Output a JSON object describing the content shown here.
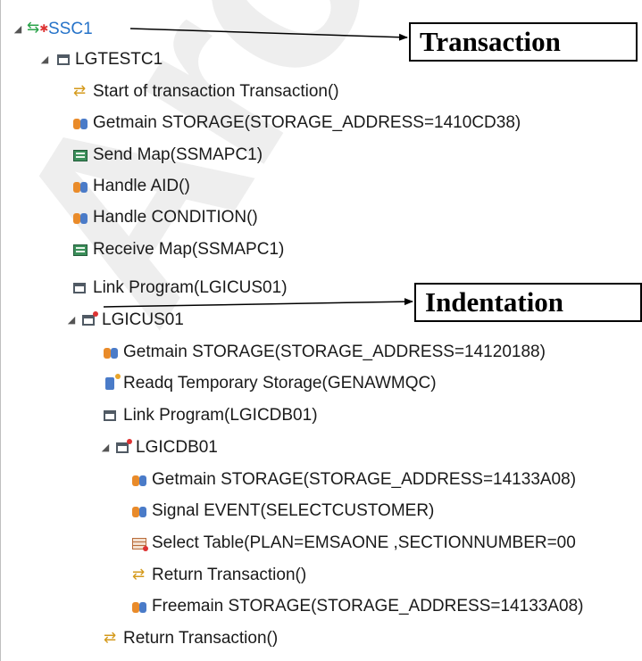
{
  "tree": [
    {
      "label": "SSC1",
      "icon": "transaction-root-icon",
      "expanded": true,
      "selected": true
    },
    {
      "label": "LGTESTC1",
      "icon": "program-icon",
      "expanded": true
    },
    {
      "label": "Start of transaction Transaction()",
      "icon": "transaction-event-icon"
    },
    {
      "label": "Getmain STORAGE(STORAGE_ADDRESS=1410CD38)",
      "icon": "storage-icon"
    },
    {
      "label": "Send Map(SSMAPC1)",
      "icon": "map-icon"
    },
    {
      "label": "Handle AID()",
      "icon": "storage-icon"
    },
    {
      "label": "Handle CONDITION()",
      "icon": "storage-icon"
    },
    {
      "label": "Receive Map(SSMAPC1)",
      "icon": "map-icon"
    },
    {
      "label": "Link Program(LGICUS01)",
      "icon": "program-icon"
    },
    {
      "label": "LGICUS01",
      "icon": "program-icon",
      "expanded": true
    },
    {
      "label": "Getmain STORAGE(STORAGE_ADDRESS=14120188)",
      "icon": "storage-icon"
    },
    {
      "label": "Readq Temporary Storage(GENAWMQC)",
      "icon": "queue-icon"
    },
    {
      "label": "Link Program(LGICDB01)",
      "icon": "program-icon"
    },
    {
      "label": "LGICDB01",
      "icon": "program-icon",
      "expanded": true
    },
    {
      "label": "Getmain STORAGE(STORAGE_ADDRESS=14133A08)",
      "icon": "storage-icon"
    },
    {
      "label": "Signal EVENT(SELECTCUSTOMER)",
      "icon": "signal-icon"
    },
    {
      "label": "Select Table(PLAN=EMSAONE ,SECTIONNUMBER=00",
      "icon": "table-icon"
    },
    {
      "label": "Return Transaction()",
      "icon": "transaction-event-icon"
    },
    {
      "label": "Freemain STORAGE(STORAGE_ADDRESS=14133A08)",
      "icon": "storage-icon"
    },
    {
      "label": "Return Transaction()",
      "icon": "transaction-event-icon"
    }
  ],
  "annotations": {
    "transaction": "Transaction",
    "indentation": "Indentation"
  },
  "watermark": "Archived",
  "colors": {
    "selected_text": "#2673c9",
    "watermark": "#cdcdcd"
  }
}
